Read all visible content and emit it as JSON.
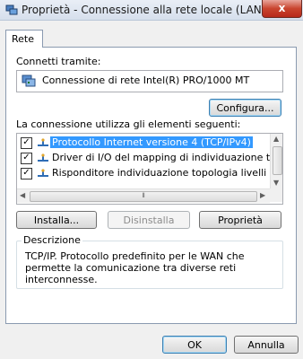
{
  "window": {
    "title": "Proprietà - Connessione alla rete locale (LAN)",
    "close_glyph": "x"
  },
  "tabs": [
    {
      "label": "Rete"
    }
  ],
  "connect_via": {
    "label": "Connetti tramite:",
    "adapter": "Connessione di rete Intel(R) PRO/1000 MT"
  },
  "buttons": {
    "configure": "Configura...",
    "install": "Installa...",
    "uninstall": "Disinstalla",
    "properties": "Proprietà",
    "ok": "OK",
    "cancel": "Annulla"
  },
  "items_label": "La connessione utilizza gli elementi seguenti:",
  "items": [
    {
      "label": "Protocollo Internet versione 4 (TCP/IPv4)",
      "checked": true,
      "selected": true,
      "icon": "network-protocol-icon"
    },
    {
      "label": "Driver di I/O del mapping di individuazione topologia liv",
      "checked": true,
      "selected": false,
      "icon": "network-protocol-icon"
    },
    {
      "label": "Risponditore individuazione topologia livelli di collegame",
      "checked": true,
      "selected": false,
      "icon": "network-protocol-icon"
    }
  ],
  "description": {
    "title": "Descrizione",
    "text": "TCP/IP. Protocollo predefinito per le WAN che permette la comunicazione tra diverse reti interconnesse."
  },
  "colors": {
    "selection": "#3399ff",
    "close": "#c9452f"
  }
}
